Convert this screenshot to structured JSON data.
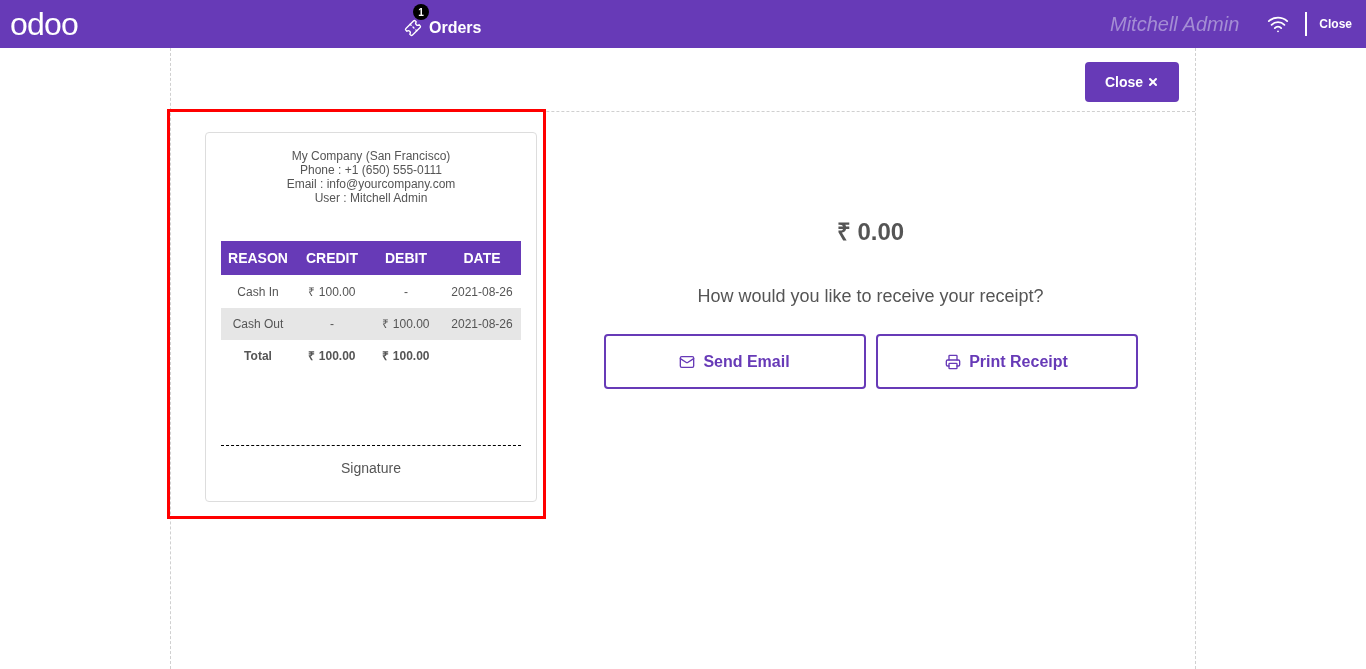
{
  "header": {
    "logo": "odoo",
    "orders": {
      "label": "Orders",
      "count": "1"
    },
    "user": "Mitchell Admin",
    "close": "Close"
  },
  "close_button": {
    "label": "Close"
  },
  "receipt": {
    "header_lines": [
      "My Company (San Francisco)",
      "Phone : +1 (650) 555-0111",
      "Email : info@yourcompany.com",
      "User : Mitchell Admin"
    ],
    "columns": [
      "REASON",
      "CREDIT",
      "DEBIT",
      "DATE"
    ],
    "rows": [
      [
        "Cash In",
        "₹ 100.00",
        "-",
        "2021-08-26"
      ],
      [
        "Cash Out",
        "-",
        "₹ 100.00",
        "2021-08-26"
      ]
    ],
    "total": [
      "Total",
      "₹ 100.00",
      "₹ 100.00"
    ],
    "signature": "Signature",
    "highlighted": true
  },
  "amount": "₹ 0.00",
  "question": "How would you like to receive your receipt?",
  "actions": [
    {
      "kind": "email",
      "label": "Send Email"
    },
    {
      "kind": "print",
      "label": "Print Receipt"
    }
  ]
}
